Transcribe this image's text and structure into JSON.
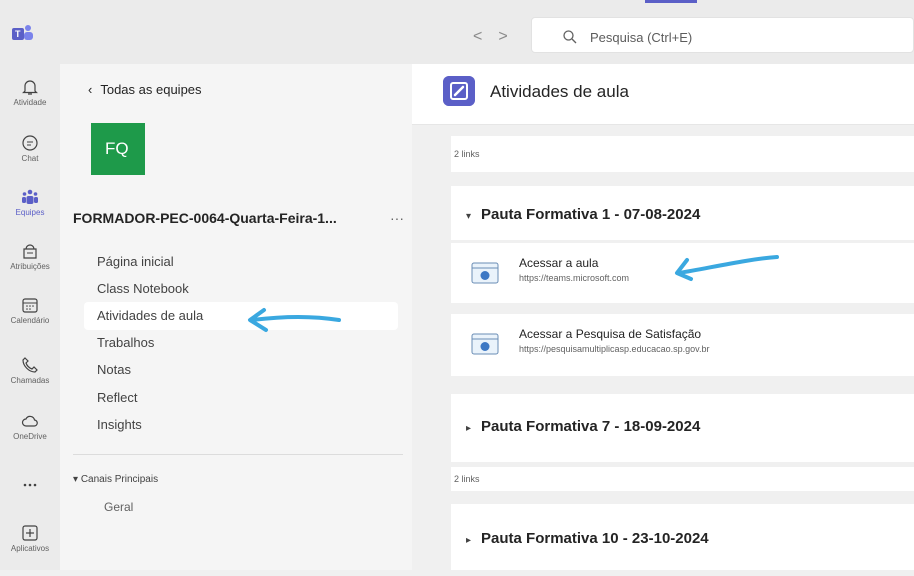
{
  "topbar": {
    "logo_icon": "teams-logo-icon",
    "search_placeholder": "Pesquisa (Ctrl+E)",
    "back_arrow": "<",
    "forward_arrow": ">"
  },
  "rail": [
    {
      "label": "Atividade",
      "icon": "bell-icon"
    },
    {
      "label": "Chat",
      "icon": "chat-icon"
    },
    {
      "label": "Equipes",
      "icon": "teams-icon",
      "active": true
    },
    {
      "label": "Atribuições",
      "icon": "assignments-icon"
    },
    {
      "label": "Calendário",
      "icon": "calendar-icon"
    },
    {
      "label": "Chamadas",
      "icon": "phone-icon"
    },
    {
      "label": "OneDrive",
      "icon": "cloud-icon"
    },
    {
      "label": "",
      "icon": "more-icon"
    },
    {
      "label": "Aplicativos",
      "icon": "add-apps-icon"
    }
  ],
  "team_panel": {
    "back_label": "Todas as equipes",
    "avatar_initials": "FQ",
    "avatar_color": "#1e9a4a",
    "team_name": "FORMADOR-PEC-0064-Quarta-Feira-1...",
    "more": "···",
    "items": [
      "Página inicial",
      "Class Notebook",
      "Atividades de aula",
      "Trabalhos",
      "Notas",
      "Reflect",
      "Insights"
    ],
    "selected_item": "Atividades de aula",
    "channels_header": "Canais Principais",
    "channels": [
      "Geral"
    ]
  },
  "main": {
    "tab_title": "Atividades de aula",
    "accent_color": "#5b5fc7",
    "top_count": "2 links",
    "sections": [
      {
        "title": "Pauta Formativa 1 - 07-08-2024",
        "expanded": true,
        "links": [
          {
            "title": "Acessar a aula",
            "url": "https://teams.microsoft.com"
          },
          {
            "title": "Acessar a Pesquisa de Satisfação",
            "url": "https://pesquisamultiplicasp.educacao.sp.gov.br"
          }
        ]
      },
      {
        "title": "Pauta Formativa 7 - 18-09-2024",
        "expanded": false,
        "count": "2 links"
      },
      {
        "title": "Pauta Formativa 10 - 23-10-2024",
        "expanded": false
      }
    ]
  },
  "annotation_color": "#3aa8e0"
}
